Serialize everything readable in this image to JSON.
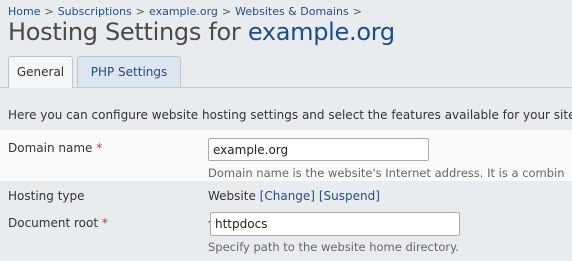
{
  "breadcrumb": {
    "items": [
      "Home",
      "Subscriptions",
      "example.org",
      "Websites & Domains"
    ],
    "separator": ">"
  },
  "page": {
    "title_prefix": "Hosting Settings for",
    "title_domain": "example.org"
  },
  "tabs": [
    {
      "label": "General",
      "active": true
    },
    {
      "label": "PHP Settings",
      "active": false
    }
  ],
  "description": "Here you can configure website hosting settings and select the features available for your site.",
  "form": {
    "domain_name": {
      "label": "Domain name",
      "required_mark": "*",
      "value": "example.org",
      "hint": "Domain name is the website's Internet address. It is a combin"
    },
    "hosting_type": {
      "label": "Hosting type",
      "value": "Website",
      "change_link": "[Change]",
      "suspend_link": "[Suspend]"
    },
    "document_root": {
      "label": "Document root",
      "required_mark": "*",
      "path_separator": "/",
      "value": "httpdocs",
      "hint": "Specify path to the website home directory.",
      "icon": "home-icon"
    }
  },
  "colors": {
    "link": "#1d4e8a",
    "required": "#c0392b",
    "background": "#e9ecef"
  }
}
